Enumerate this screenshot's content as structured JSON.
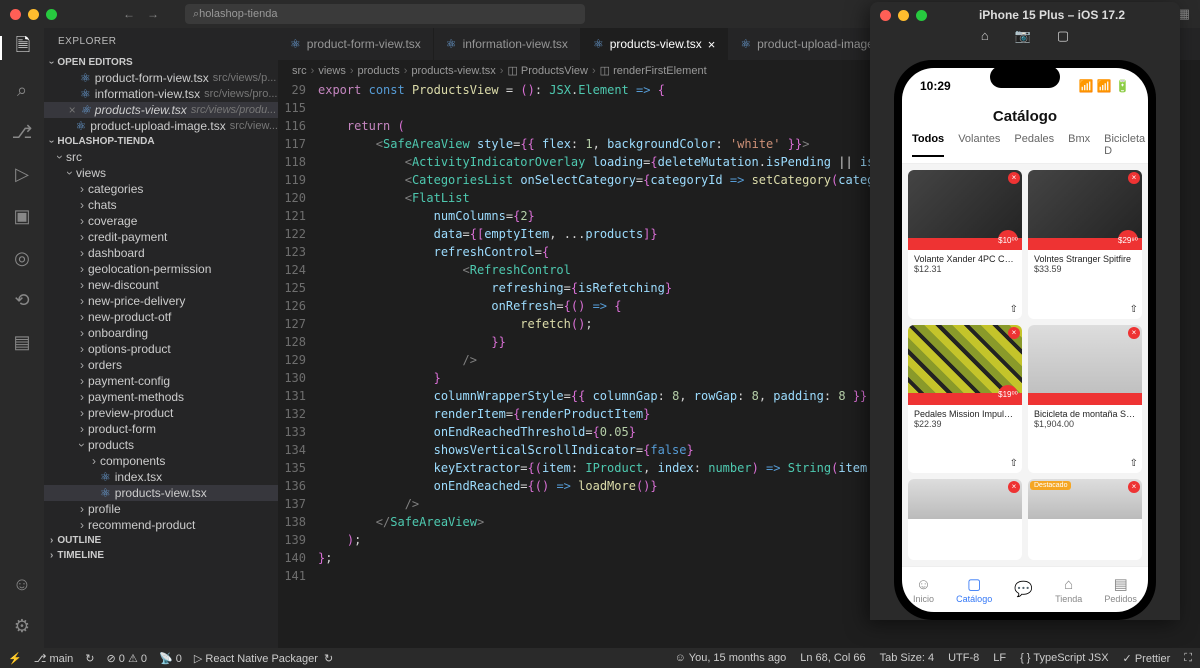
{
  "titlebar": {
    "search": "holashop-tienda"
  },
  "explorer": {
    "title": "EXPLORER",
    "openEditors": "OPEN EDITORS",
    "workspace": "HOLASHOP-TIENDA",
    "outline": "OUTLINE",
    "timeline": "TIMELINE",
    "editors": [
      {
        "name": "product-form-view.tsx",
        "path": "src/views/p..."
      },
      {
        "name": "information-view.tsx",
        "path": "src/views/pro..."
      },
      {
        "name": "products-view.tsx",
        "path": "src/views/produ...",
        "active": true
      },
      {
        "name": "product-upload-image.tsx",
        "path": "src/view..."
      }
    ],
    "topFolders": [
      "src"
    ],
    "viewsHdr": "views",
    "folders": [
      "categories",
      "chats",
      "coverage",
      "credit-payment",
      "dashboard",
      "geolocation-permission",
      "new-discount",
      "new-price-delivery",
      "new-product-otf",
      "onboarding",
      "options-product",
      "orders",
      "payment-config",
      "payment-methods",
      "preview-product",
      "product-form"
    ],
    "productsFolder": "products",
    "componentsFolder": "components",
    "productFiles": [
      "index.tsx",
      "products-view.tsx"
    ],
    "moreFolders": [
      "profile",
      "recommend-product"
    ]
  },
  "tabs": [
    {
      "label": "product-form-view.tsx"
    },
    {
      "label": "information-view.tsx"
    },
    {
      "label": "products-view.tsx",
      "active": true
    },
    {
      "label": "product-upload-image...."
    }
  ],
  "breadcrumbs": [
    "src",
    "views",
    "products",
    "products-view.tsx",
    "ProductsView",
    "renderFirstElement"
  ],
  "lineNumbers": [
    "29",
    "115",
    "116",
    "117",
    "118",
    "119",
    "120",
    "121",
    "122",
    "123",
    "124",
    "125",
    "126",
    "127",
    "128",
    "129",
    "130",
    "131",
    "132",
    "133",
    "134",
    "135",
    "136",
    "137",
    "138",
    "139",
    "140",
    "141"
  ],
  "statusbar": {
    "branch": "main",
    "sync": "↻",
    "errors": "0",
    "warnings": "0",
    "radio": "0",
    "packager": "React Native Packager",
    "blame": "You, 15 months ago",
    "ln": "Ln 68, Col 66",
    "tab": "Tab Size: 4",
    "enc": "UTF-8",
    "eol": "LF",
    "lang": "TypeScript JSX",
    "prettier": "Prettier"
  },
  "simulator": {
    "title": "iPhone 15 Plus – iOS 17.2",
    "time": "10:29",
    "header": "Catálogo",
    "cats": [
      "Todos",
      "Volantes",
      "Pedales",
      "Bmx",
      "Bicicleta D"
    ],
    "products": [
      {
        "t": "Volante Xander 4PC Cro...",
        "p": "$12.31",
        "tag": "$10⁰⁰",
        "cls": ""
      },
      {
        "t": "Volntes Stranger Spitfire",
        "p": "$33.59",
        "tag": "$29⁹⁰",
        "cls": ""
      },
      {
        "t": "Pedales Mission Impulse...",
        "p": "$22.39",
        "tag": "$19⁰⁰",
        "cls": "camo"
      },
      {
        "t": "Bicicleta de montaña Sc...",
        "p": "$1,904.00",
        "tag": "",
        "cls": "bike"
      }
    ],
    "featured": "Destacado",
    "tabbar": [
      {
        "l": "Inicio",
        "i": "☺"
      },
      {
        "l": "Catálogo",
        "i": "▢",
        "active": true
      },
      {
        "l": "",
        "i": "💬"
      },
      {
        "l": "Tienda",
        "i": "⌂"
      },
      {
        "l": "Pedidos",
        "i": "▤"
      }
    ]
  }
}
